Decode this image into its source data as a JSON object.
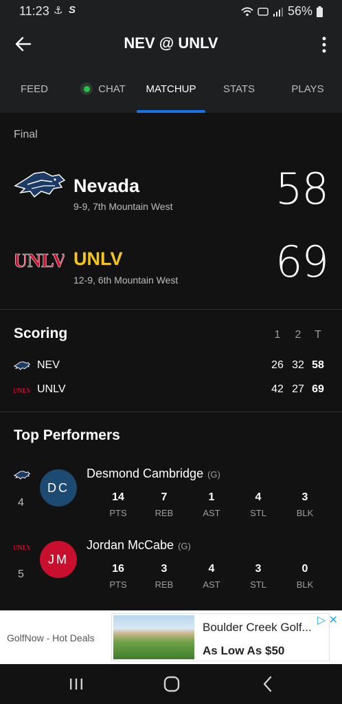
{
  "status": {
    "time": "11:23",
    "battery": "56%"
  },
  "header": {
    "title": "NEV @ UNLV"
  },
  "tabs": [
    {
      "label": "FEED"
    },
    {
      "label": "CHAT"
    },
    {
      "label": "MATCHUP"
    },
    {
      "label": "STATS"
    },
    {
      "label": "PLAYS"
    }
  ],
  "game": {
    "status": "Final",
    "away": {
      "name": "Nevada",
      "record": "9-9, 7th Mountain West",
      "score": "58",
      "color": "#ffffff"
    },
    "home": {
      "name": "UNLV",
      "record": "12-9, 6th Mountain West",
      "score": "69",
      "color": "#f5c518",
      "logo_text": "UNLV"
    }
  },
  "scoring": {
    "title": "Scoring",
    "headers": [
      "1",
      "2",
      "T"
    ],
    "rows": [
      {
        "team": "NEV",
        "p1": "26",
        "p2": "32",
        "total": "58"
      },
      {
        "team": "UNLV",
        "p1": "42",
        "p2": "27",
        "total": "69",
        "logo_text": "UNLV"
      }
    ]
  },
  "top_performers": {
    "title": "Top Performers",
    "players": [
      {
        "number": "4",
        "initials": "DC",
        "name": "Desmond Cambridge",
        "position": "(G)",
        "avatar_color": "#1d4a72",
        "stats": [
          {
            "value": "14",
            "label": "PTS"
          },
          {
            "value": "7",
            "label": "REB"
          },
          {
            "value": "1",
            "label": "AST"
          },
          {
            "value": "4",
            "label": "STL"
          },
          {
            "value": "3",
            "label": "BLK"
          }
        ]
      },
      {
        "number": "5",
        "initials": "JM",
        "name": "Jordan McCabe",
        "position": "(G)",
        "avatar_color": "#c8102e",
        "logo_text": "UNLV",
        "stats": [
          {
            "value": "16",
            "label": "PTS"
          },
          {
            "value": "3",
            "label": "REB"
          },
          {
            "value": "4",
            "label": "AST"
          },
          {
            "value": "3",
            "label": "STL"
          },
          {
            "value": "0",
            "label": "BLK"
          }
        ]
      }
    ]
  },
  "ad": {
    "brand": "GolfNow - Hot Deals",
    "headline": "Boulder Creek Golf...",
    "subline": "As Low As $50"
  },
  "colors": {
    "accent": "#1a73e8",
    "chat_online": "#27c24a",
    "unlv_red": "#c8102e"
  }
}
